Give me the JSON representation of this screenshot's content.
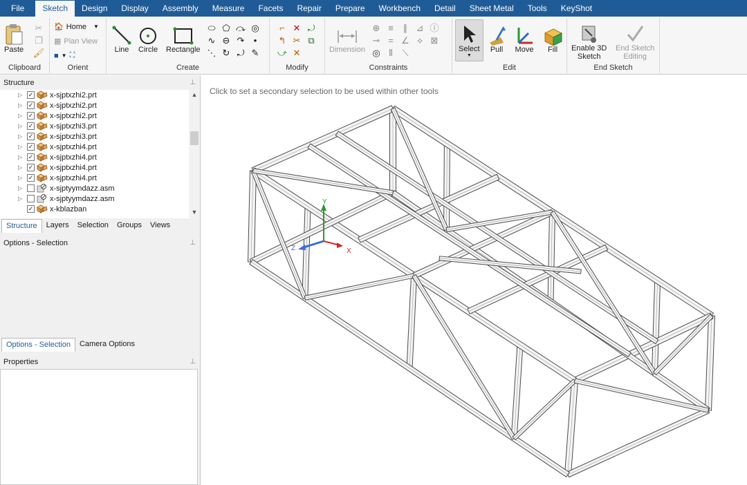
{
  "menu": {
    "tabs": [
      "File",
      "Sketch",
      "Design",
      "Display",
      "Assembly",
      "Measure",
      "Facets",
      "Repair",
      "Prepare",
      "Workbench",
      "Detail",
      "Sheet Metal",
      "Tools",
      "KeyShot"
    ],
    "active": "Sketch"
  },
  "ribbon": {
    "clipboard": {
      "label": "Clipboard",
      "paste": "Paste"
    },
    "orient": {
      "label": "Orient",
      "home": "Home",
      "plan_view": "Plan View"
    },
    "create": {
      "label": "Create",
      "line": "Line",
      "circle": "Circle",
      "rectangle": "Rectangle"
    },
    "modify": {
      "label": "Modify"
    },
    "constraints": {
      "label": "Constraints",
      "dimension": "Dimension"
    },
    "edit": {
      "label": "Edit",
      "select": "Select",
      "pull": "Pull",
      "move": "Move",
      "fill": "Fill"
    },
    "end_sketch": {
      "label": "End Sketch",
      "enable_line1": "Enable 3D",
      "enable_line2": "Sketch",
      "end_line1": "End Sketch",
      "end_line2": "Editing"
    }
  },
  "structure": {
    "title": "Structure",
    "items": [
      {
        "name": "x-sjptxzhi2.prt",
        "checked": "✓"
      },
      {
        "name": "x-sjptxzhi2.prt",
        "checked": "✓"
      },
      {
        "name": "x-sjptxzhi2.prt",
        "checked": "✓"
      },
      {
        "name": "x-sjptxzhi3.prt",
        "checked": "✓"
      },
      {
        "name": "x-sjptxzhi3.prt",
        "checked": "✓"
      },
      {
        "name": "x-sjptxzhi4.prt",
        "checked": "✓"
      },
      {
        "name": "x-sjptxzhi4.prt",
        "checked": "✓"
      },
      {
        "name": "x-sjptxzhi4.prt",
        "checked": "✓"
      },
      {
        "name": "x-sjptxzhi4.prt",
        "checked": "✓"
      },
      {
        "name": "x-sjptyymdazz.asm",
        "checked": ""
      },
      {
        "name": "x-sjptyymdazz.asm",
        "checked": ""
      },
      {
        "name": "x-kblazban",
        "checked": "✓"
      }
    ],
    "tabs": [
      "Structure",
      "Layers",
      "Selection",
      "Groups",
      "Views"
    ]
  },
  "options": {
    "title": "Options - Selection",
    "tabs": [
      "Options - Selection",
      "Camera Options"
    ]
  },
  "properties": {
    "title": "Properties"
  },
  "viewport": {
    "hint": "Click to set a secondary selection to be used within other tools",
    "axes": {
      "x": "X",
      "y": "Y",
      "z": "Z"
    }
  },
  "colors": {
    "menubar": "#1f5c97",
    "ribbon": "#f6f6f6",
    "frame_fill": "#f4f4f4",
    "frame_stroke": "#4a4a4a"
  }
}
